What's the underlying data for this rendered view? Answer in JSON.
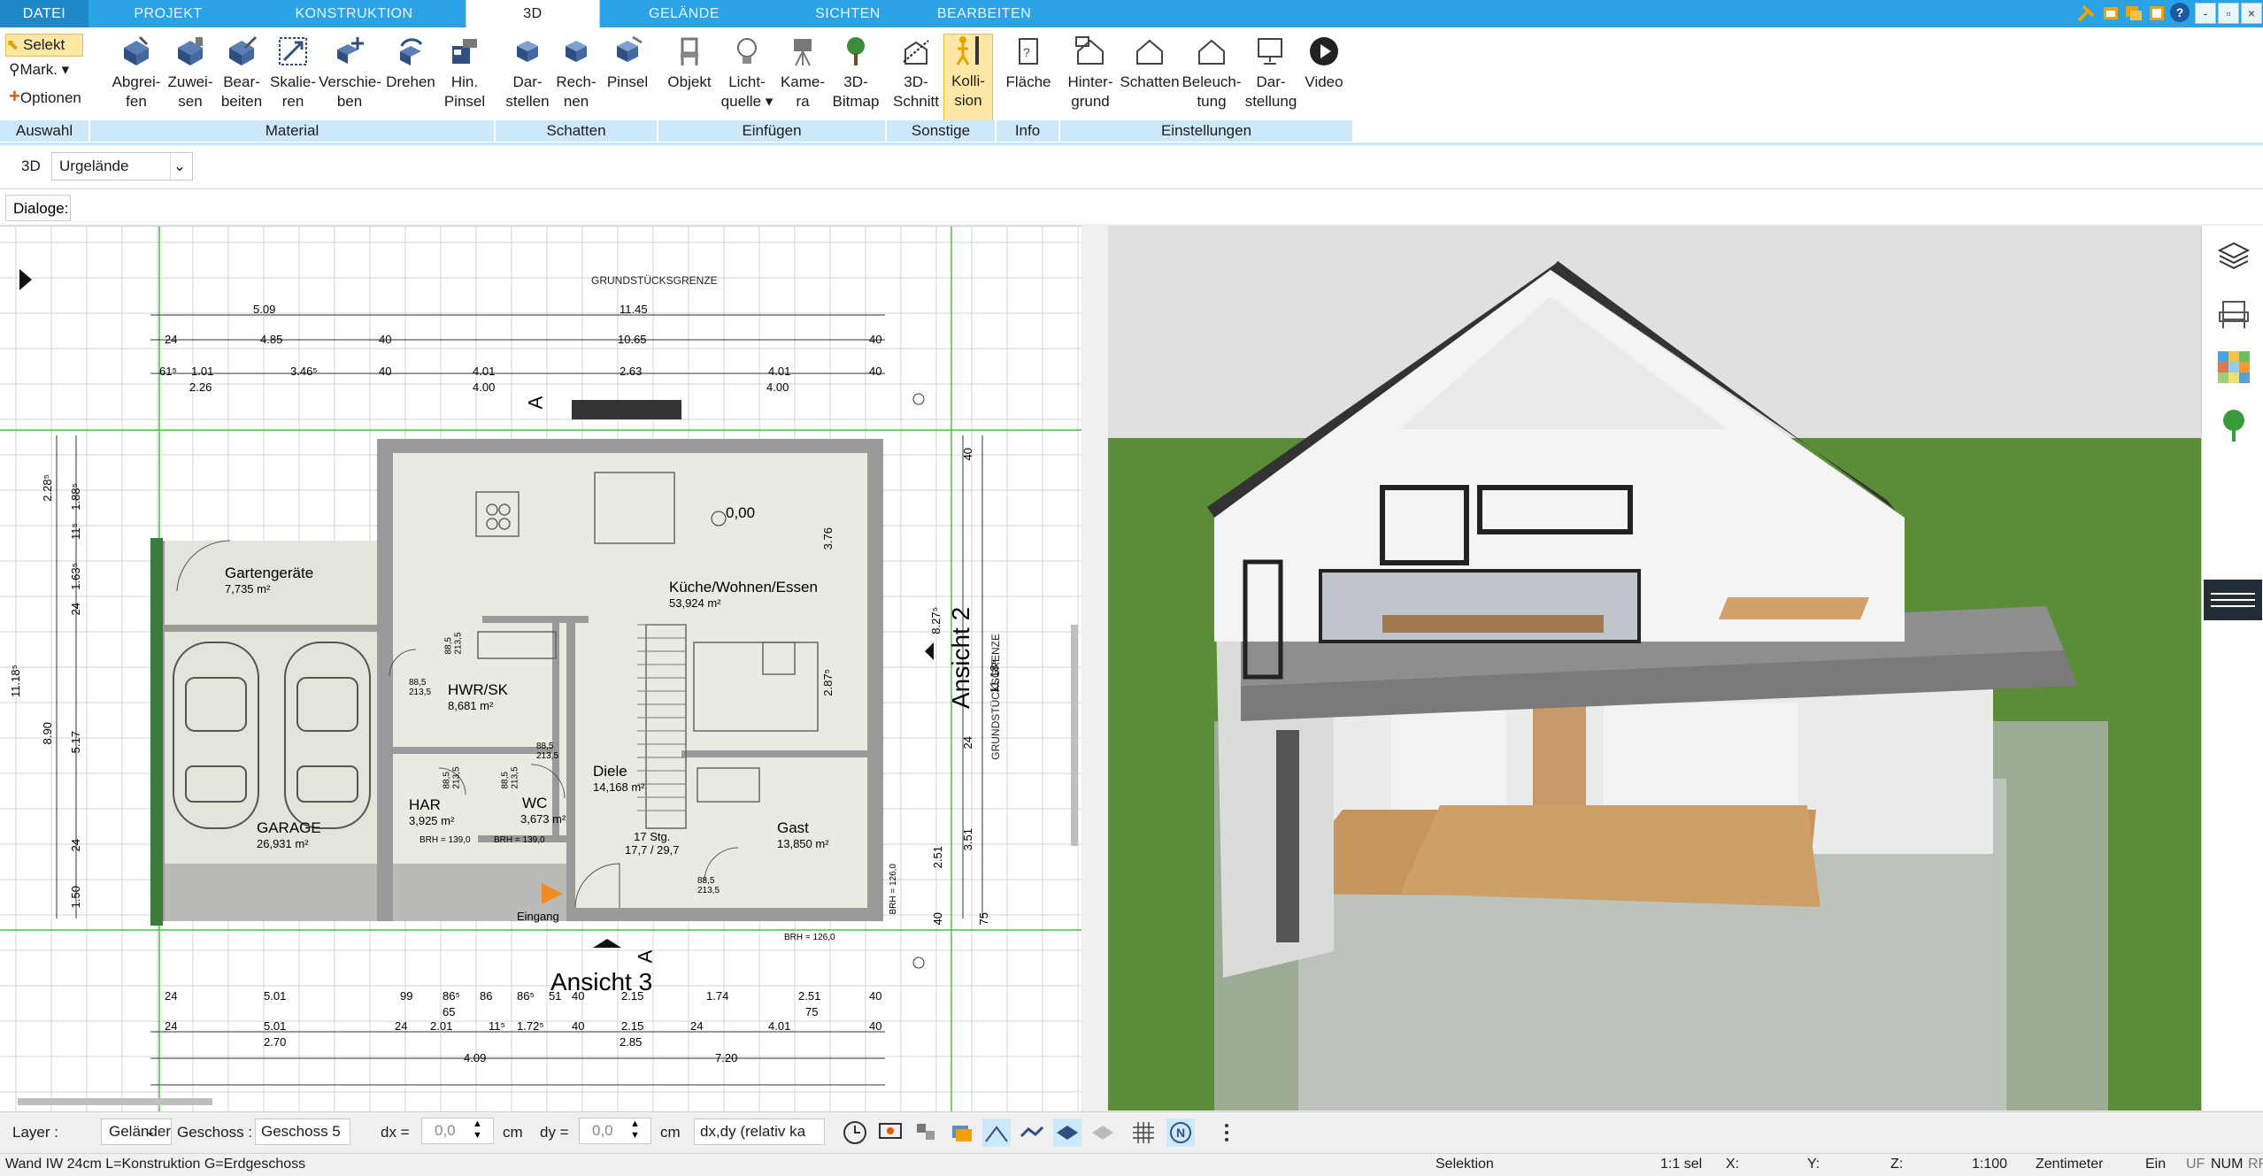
{
  "tabs": [
    {
      "label": "DATEI"
    },
    {
      "label": "PROJEKT"
    },
    {
      "label": "KONSTRUKTION"
    },
    {
      "label": "3D"
    },
    {
      "label": "GELÄNDE"
    },
    {
      "label": "SICHTEN"
    },
    {
      "label": "BEARBEITEN"
    }
  ],
  "window_controls": {
    "minimize": "-",
    "restore": "▫",
    "close": "×",
    "help": "?"
  },
  "ribbon": {
    "auswahl": {
      "select": "Selekt",
      "mark": "Mark.",
      "options": "Optionen",
      "group": "Auswahl"
    },
    "material": {
      "group": "Material",
      "buttons": [
        "Abgrei-\nfen",
        "Zuwei-\nsen",
        "Bear-\nbeiten",
        "Skalie-\nren",
        "Verschie-\nben",
        "Drehen",
        "Hin.\nPinsel"
      ]
    },
    "schatten": {
      "group": "Schatten",
      "buttons": [
        "Dar-\nstellen",
        "Rech-\nnen",
        "Pinsel"
      ]
    },
    "einfuegen": {
      "group": "Einfügen",
      "buttons": [
        "Objekt",
        "Licht-\nquelle ▾",
        "Kame-\nra",
        "3D-\nBitmap"
      ]
    },
    "sonstige": {
      "group": "Sonstige",
      "buttons": [
        "3D-\nSchnitt",
        "Kolli-\nsion"
      ]
    },
    "info": {
      "group": "Info",
      "buttons": [
        "Fläche"
      ]
    },
    "einstellungen": {
      "group": "Einstellungen",
      "buttons": [
        "Hinter-\ngrund",
        "Schatten",
        "Beleuch-\ntung",
        "Dar-\nstellung",
        "Video"
      ]
    }
  },
  "view_selector": {
    "mode": "3D",
    "value": "Urgelände"
  },
  "dialoge_label": "Dialoge:",
  "plan": {
    "boundary_label": "GRUNDSTÜCKSGRENZE",
    "boundary_label_right": "GRUNDSTÜCKSGRENZE",
    "dims_top": [
      "5.09",
      "11.45",
      "24",
      "4.85",
      "40",
      "10.65",
      "40",
      "61⁵",
      "1.01",
      "3.46⁵",
      "40",
      "4.01",
      "2.63",
      "4.01",
      "40",
      "2.26",
      "4.00",
      "4.00"
    ],
    "dims_left": [
      "2.28⁵",
      "1.88⁵",
      "11⁵",
      "1.63⁵",
      "24",
      "11.18⁵",
      "8.90",
      "5.17",
      "24",
      "1.50"
    ],
    "dims_right": [
      "8.27⁵",
      "3.76",
      "2.87⁵",
      "24",
      "2.51",
      "3.51",
      "40",
      "11.18⁵",
      "40",
      "75"
    ],
    "dims_bottom": [
      "24",
      "5.01",
      "99",
      "86⁵",
      "86",
      "86⁵",
      "51",
      "40",
      "2.15",
      "1.74",
      "2.51",
      "40",
      "65",
      "75",
      "24",
      "5.01",
      "24",
      "2.01",
      "11⁵",
      "1.72⁵",
      "40",
      "2.15",
      "24",
      "4.01",
      "40",
      "2.70",
      "2.85",
      "4.09",
      "7.20"
    ],
    "rooms": [
      {
        "name": "Gartengeräte",
        "area": "7,735 m²"
      },
      {
        "name": "Küche/Wohnen/Essen",
        "area": "53,924 m²"
      },
      {
        "name": "HWR/SK",
        "area": "8,681 m²"
      },
      {
        "name": "GARAGE",
        "area": "26,931 m²"
      },
      {
        "name": "HAR",
        "area": "3,925 m²"
      },
      {
        "name": "WC",
        "area": "3,673 m²"
      },
      {
        "name": "Diele",
        "area": "14,168 m²"
      },
      {
        "name": "Gast",
        "area": "13,850 m²"
      }
    ],
    "stairs": "17 Stg.\n17,7 / 29,7",
    "level": "0,00",
    "entrance": "Eingang",
    "section_marks": [
      "A",
      "A"
    ],
    "views": [
      "Ansicht 2",
      "Ansicht 3"
    ],
    "brh": [
      "BRH = 139,0",
      "BRH = 139,0",
      "BRH = 126,0",
      "BRH = 126,0"
    ],
    "door_dims": [
      "88,5\n213,5",
      "88,5\n213,5",
      "88,5\n213,5",
      "88,5\n213,5",
      "88,5\n213,5",
      "88,5\n213,5"
    ]
  },
  "bottom": {
    "layer_label": "Layer :",
    "layer_value": "Geländer",
    "geschoss_label": "Geschoss :",
    "geschoss_value": "Geschoss 5",
    "dx_label": "dx =",
    "dx_value": "0,0",
    "dx_unit": "cm",
    "dy_label": "dy =",
    "dy_value": "0,0",
    "dy_unit": "cm",
    "mode_value": "dx,dy (relativ ka"
  },
  "status": {
    "left": "Wand IW 24cm L=Konstruktion G=Erdgeschoss",
    "mode": "Selektion",
    "sel": "1:1 sel",
    "x": "X:",
    "y": "Y:",
    "z": "Z:",
    "scale": "1:100",
    "unit": "Zentimeter",
    "ein": "Ein",
    "uf": "UF",
    "num": "NUM",
    "rf": "RF"
  },
  "colors": {
    "accent": "#29a3e6",
    "group_bg": "#cde8f9",
    "highlight": "#ffe8a6",
    "grass": "#5b8c38",
    "sky": "#e0e0e0"
  }
}
